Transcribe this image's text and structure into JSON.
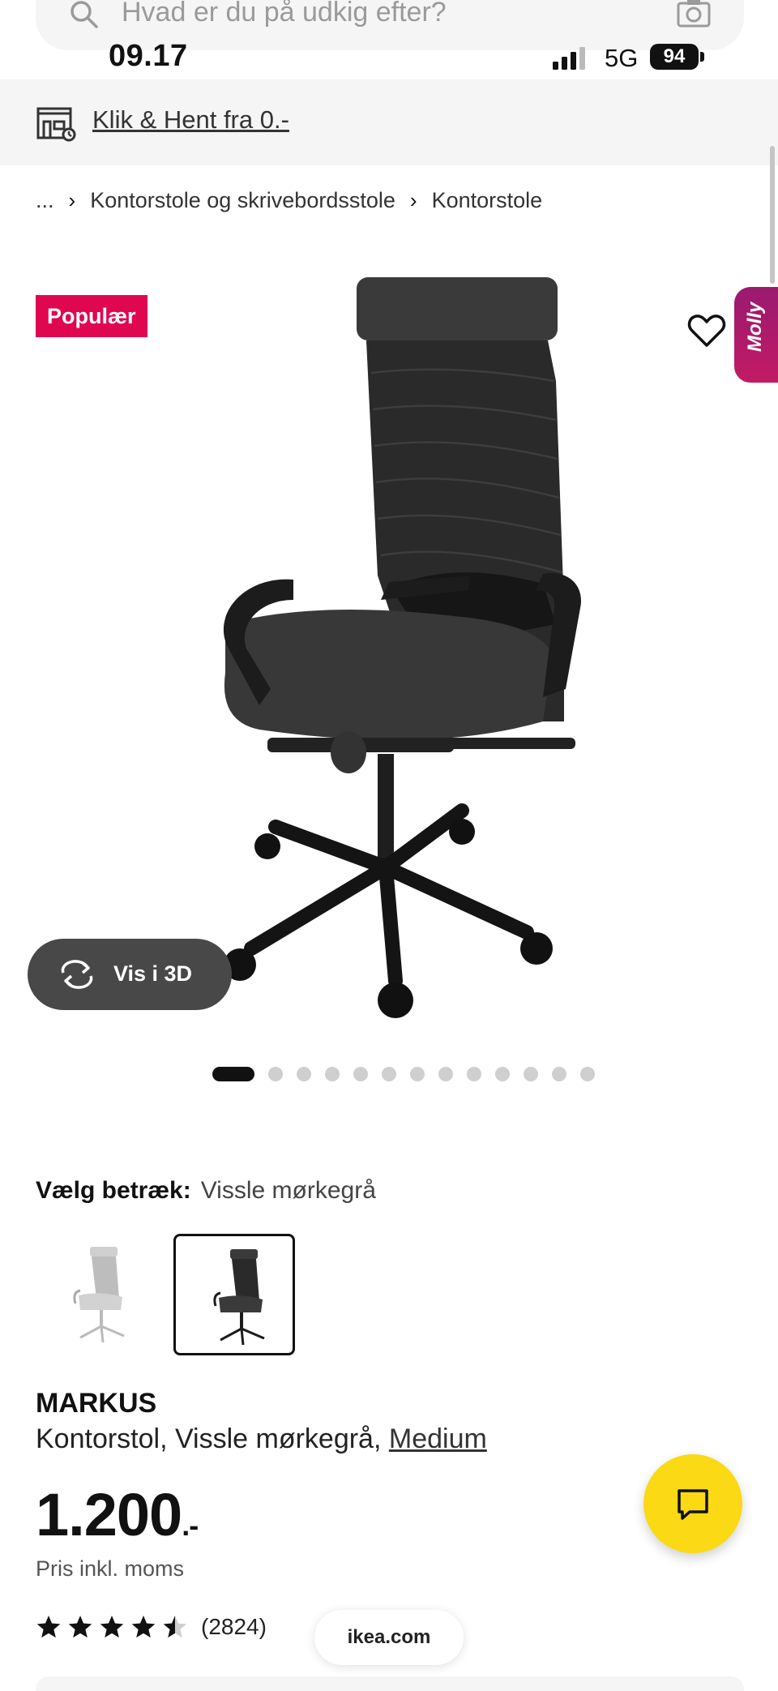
{
  "search": {
    "placeholder": "Hvad er du på udkig efter?"
  },
  "status_bar": {
    "time": "09.17",
    "network": "5G",
    "battery": "94"
  },
  "banner": {
    "text": "Klik & Hent fra 0.-"
  },
  "breadcrumb": {
    "ellipsis": "...",
    "items": [
      "Kontorstole og skrivebordsstole",
      "Kontorstole"
    ]
  },
  "badge": {
    "label": "Populær"
  },
  "molly": {
    "label": "Molly"
  },
  "view3d": {
    "label": "Vis i 3D"
  },
  "carousel": {
    "total": 13,
    "active_index": 0
  },
  "variant": {
    "label": "Vælg betræk:",
    "value": "Vissle mørkegrå",
    "options": [
      "light-grey",
      "dark-grey"
    ],
    "selected_index": 1
  },
  "product": {
    "name": "MARKUS",
    "description": "Kontorstol, Vissle mørkegrå,",
    "size_link": "Medium",
    "price_main": "1.200",
    "price_suffix": ".-",
    "price_note": "Pris inkl. moms",
    "rating": 4.5,
    "review_count": "(2824)"
  },
  "url": "ikea.com",
  "colors": {
    "badge": "#e00751",
    "chat": "#fbd914",
    "molly": "#b01a68"
  }
}
